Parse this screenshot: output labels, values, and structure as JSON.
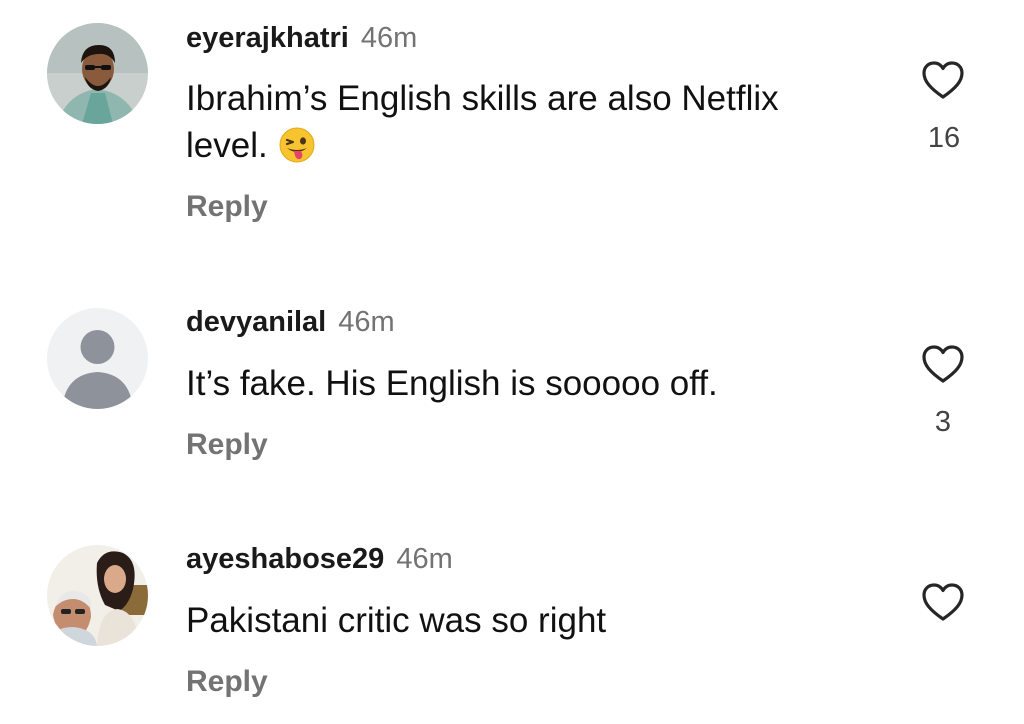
{
  "comments": [
    {
      "username": "eyerajkhatri",
      "time": "46m",
      "text_line1": "Ibrahim’s English skills are also Netflix",
      "text_line2": "level.",
      "emoji": "winking-face-with-tongue",
      "reply_label": "Reply",
      "like_count": "16"
    },
    {
      "username": "devyanilal",
      "time": "46m",
      "text": "It’s fake. His English is sooooo off.",
      "reply_label": "Reply",
      "like_count": "3"
    },
    {
      "username": "ayeshabose29",
      "time": "46m",
      "text": "Pakistani critic was so right",
      "reply_label": "Reply"
    }
  ]
}
